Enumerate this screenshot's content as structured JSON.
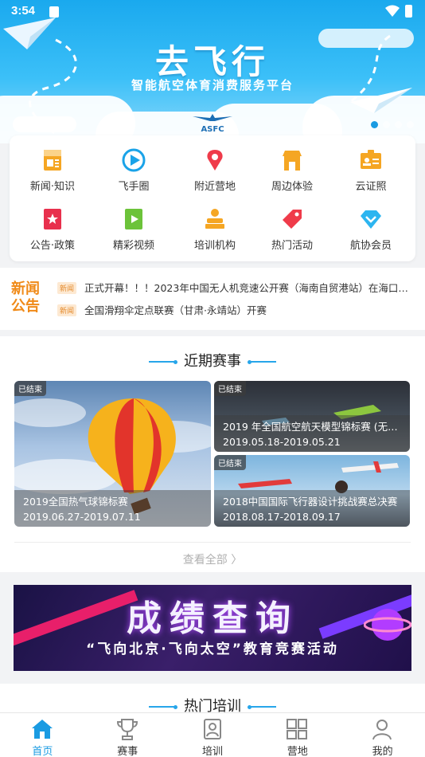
{
  "status_bar": {
    "time": "3:54"
  },
  "hero": {
    "title": "去飞行",
    "subtitle": "智能航空体育消费服务平台",
    "logo_text": "ASFC",
    "active_slide": 1,
    "slide_count": 4
  },
  "menu": [
    {
      "label": "新闻·知识",
      "icon": "news-icon",
      "color": "#f5a623"
    },
    {
      "label": "飞手圈",
      "icon": "play-circle-icon",
      "color": "#1aa3e8"
    },
    {
      "label": "附近营地",
      "icon": "map-pin-icon",
      "color": "#ef3b4a"
    },
    {
      "label": "周边体验",
      "icon": "shop-icon",
      "color": "#f5a623"
    },
    {
      "label": "云证照",
      "icon": "id-card-icon",
      "color": "#f5a623"
    },
    {
      "label": "公告·政策",
      "icon": "bookmark-icon",
      "color": "#e8304d"
    },
    {
      "label": "精彩视频",
      "icon": "video-icon",
      "color": "#6cc33a"
    },
    {
      "label": "培训机构",
      "icon": "lecturer-icon",
      "color": "#f5a623"
    },
    {
      "label": "热门活动",
      "icon": "tag-icon",
      "color": "#ef3b4a"
    },
    {
      "label": "航协会员",
      "icon": "diamond-icon",
      "color": "#2cb5f0"
    }
  ],
  "news": {
    "tag": "新闻公告",
    "items": [
      {
        "badge": "新闻",
        "text": "正式开幕！！！2023年中国无人机竞速公开赛（海南自贸港站）在海口市..."
      },
      {
        "badge": "新闻",
        "text": "全国滑翔伞定点联赛（甘肃·永靖站）开赛"
      }
    ]
  },
  "events": {
    "title": "近期赛事",
    "more": "查看全部",
    "cards": [
      {
        "status": "已结束",
        "name": "2019全国热气球锦标赛",
        "dates": "2019.06.27-2019.07.11"
      },
      {
        "status": "已结束",
        "name": "2019 年全国航空航天模型锦标赛 (无人...",
        "dates": "2019.05.18-2019.05.21"
      },
      {
        "status": "已结束",
        "name": "2018中国国际飞行器设计挑战赛总决赛",
        "dates": "2018.08.17-2018.09.17"
      }
    ]
  },
  "banner": {
    "title": "成绩查询",
    "subtitle": "“飞向北京·飞向太空”教育竞赛活动"
  },
  "training": {
    "title": "热门培训"
  },
  "tabs": [
    {
      "label": "首页",
      "icon": "home-icon",
      "active": true
    },
    {
      "label": "赛事",
      "icon": "trophy-icon",
      "active": false
    },
    {
      "label": "培训",
      "icon": "training-icon",
      "active": false
    },
    {
      "label": "营地",
      "icon": "grid-icon",
      "active": false
    },
    {
      "label": "我的",
      "icon": "user-icon",
      "active": false
    }
  ],
  "colors": {
    "accent": "#1a9be2",
    "orange": "#f08a18"
  }
}
